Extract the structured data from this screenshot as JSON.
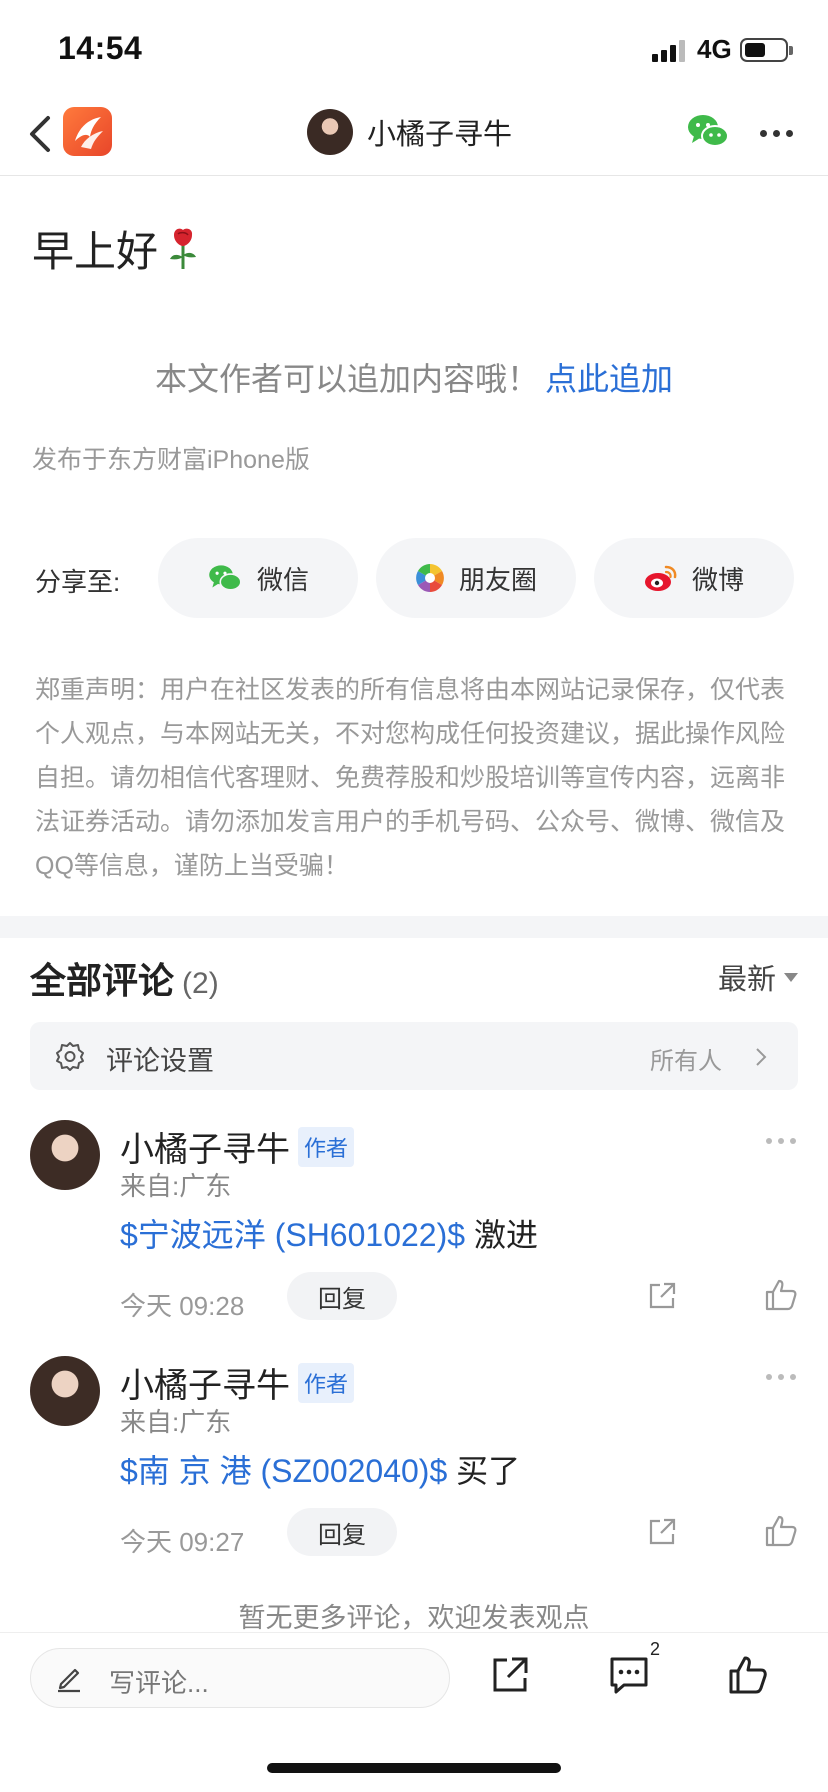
{
  "status_bar": {
    "time": "14:54",
    "network": "4G"
  },
  "nav": {
    "title": "小橘子寻牛"
  },
  "post": {
    "title": "早上好",
    "append_hint": "本文作者可以追加内容哦！",
    "append_link": "点此追加",
    "source": "发布于东方财富iPhone版"
  },
  "share": {
    "label": "分享至:",
    "targets": [
      {
        "label": "微信",
        "icon": "wechat-icon"
      },
      {
        "label": "朋友圈",
        "icon": "moments-icon"
      },
      {
        "label": "微博",
        "icon": "weibo-icon"
      }
    ]
  },
  "disclaimer": "郑重声明：用户在社区发表的所有信息将由本网站记录保存，仅代表个人观点，与本网站无关，不对您构成任何投资建议，据此操作风险自担。请勿相信代客理财、免费荐股和炒股培训等宣传内容，远离非法证券活动。请勿添加发言用户的手机号码、公众号、微博、微信及QQ等信息，谨防上当受骗！",
  "comments_section": {
    "title": "全部评论",
    "count": "(2)",
    "sort": "最新",
    "settings_label": "评论设置",
    "settings_value": "所有人",
    "items": [
      {
        "author": "小橘子寻牛",
        "badge": "作者",
        "location": "来自:广东",
        "stock": "$宁波远洋 (SH601022)$",
        "text": "激进",
        "time": "今天 09:28",
        "reply": "回复"
      },
      {
        "author": "小橘子寻牛",
        "badge": "作者",
        "location": "来自:广东",
        "stock": "$南 京 港 (SZ002040)$",
        "text": "买了",
        "time": "今天 09:27",
        "reply": "回复"
      }
    ],
    "no_more": "暂无更多评论，欢迎发表观点"
  },
  "bottom_bar": {
    "placeholder": "写评论...",
    "comments_count": "2"
  },
  "colors": {
    "link": "#2a6fd6",
    "brand": "#f0602f",
    "wechat": "#3fba4a"
  }
}
